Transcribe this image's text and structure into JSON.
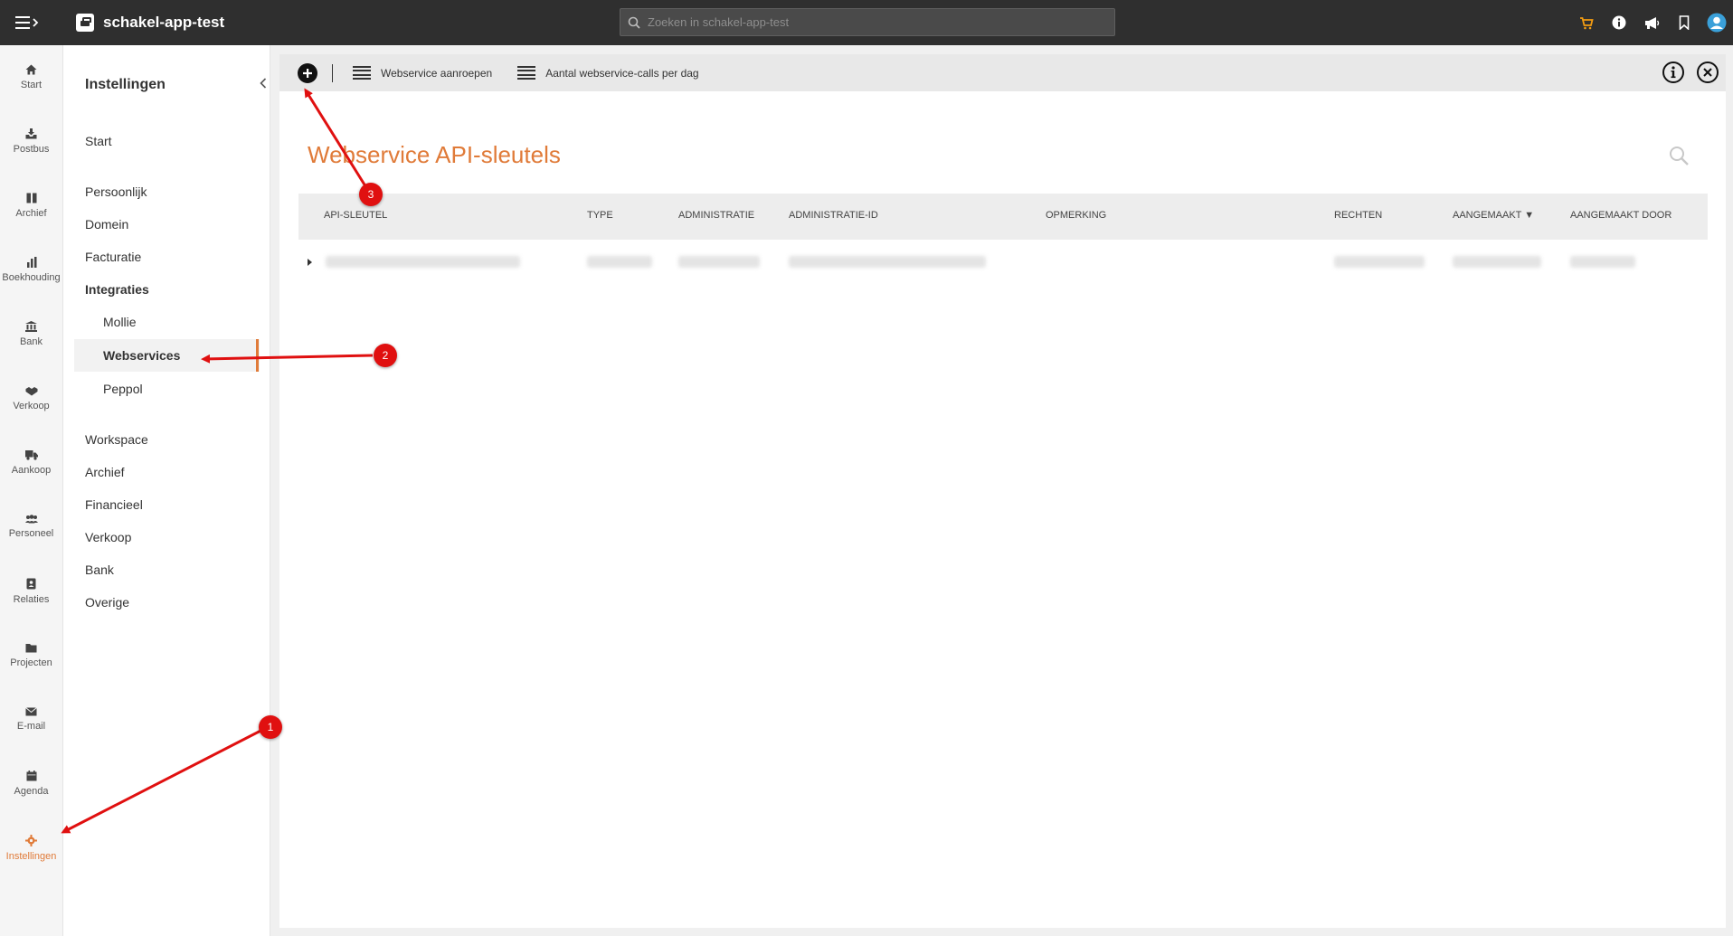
{
  "topbar": {
    "app_title": "schakel-app-test",
    "search_placeholder": "Zoeken in schakel-app-test",
    "icons": [
      "cart-icon",
      "info-icon",
      "megaphone-icon",
      "bookmark-icon",
      "user-avatar-icon"
    ]
  },
  "rail": {
    "items": [
      {
        "label": "Start",
        "icon": "home-icon"
      },
      {
        "label": "Postbus",
        "icon": "inbox-icon"
      },
      {
        "label": "Archief",
        "icon": "archive-icon"
      },
      {
        "label": "Boekhouding",
        "icon": "bar-chart-icon"
      },
      {
        "label": "Bank",
        "icon": "bank-icon"
      },
      {
        "label": "Verkoop",
        "icon": "handshake-icon"
      },
      {
        "label": "Aankoop",
        "icon": "truck-icon"
      },
      {
        "label": "Personeel",
        "icon": "users-icon"
      },
      {
        "label": "Relaties",
        "icon": "contacts-icon"
      },
      {
        "label": "Projecten",
        "icon": "folder-icon"
      },
      {
        "label": "E-mail",
        "icon": "envelope-icon"
      },
      {
        "label": "Agenda",
        "icon": "calendar-icon"
      },
      {
        "label": "Instellingen",
        "icon": "gear-icon"
      }
    ],
    "active": "Instellingen"
  },
  "settings_nav": {
    "title": "Instellingen",
    "items": {
      "start": "Start",
      "persoonlijk": "Persoonlijk",
      "domein": "Domein",
      "facturatie": "Facturatie",
      "integraties": "Integraties",
      "mollie": "Mollie",
      "webservices": "Webservices",
      "peppol": "Peppol",
      "workspace": "Workspace",
      "archief": "Archief",
      "financieel": "Financieel",
      "verkoop": "Verkoop",
      "bank": "Bank",
      "overige": "Overige"
    }
  },
  "toolbar": {
    "call_webservice": "Webservice aanroepen",
    "calls_per_day": "Aantal webservice-calls per dag"
  },
  "main": {
    "title": "Webservice API-sleutels",
    "columns": {
      "api_key": "API-SLEUTEL",
      "type": "TYPE",
      "administratie": "ADMINISTRATIE",
      "administratie_id": "ADMINISTRATIE-ID",
      "opmerking": "OPMERKING",
      "rechten": "RECHTEN",
      "aangemaakt": "AANGEMAAKT ▼",
      "aangemaakt_door": "AANGEMAAKT DOOR"
    }
  },
  "annotations": {
    "badge1": "1",
    "badge2": "2",
    "badge3": "3",
    "arrow_color": "#e01010"
  },
  "colors": {
    "accent": "#e07b39",
    "topbar": "#2f2f2f"
  }
}
